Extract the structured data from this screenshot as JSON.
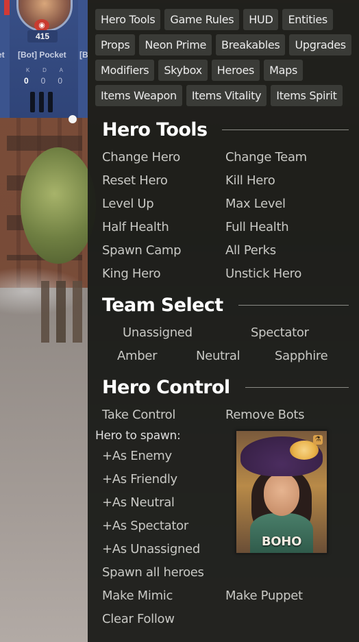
{
  "hud": {
    "players": [
      {
        "name": "et",
        "level": null
      },
      {
        "name": "[Bot] Pocket",
        "level": "415",
        "kda_labels": [
          "K",
          "D",
          "A"
        ],
        "kda": [
          "0",
          "0",
          "0"
        ]
      },
      {
        "name": "[B",
        "level": null
      }
    ]
  },
  "tabs": [
    "Hero Tools",
    "Game Rules",
    "HUD",
    "Entities",
    "Props",
    "Neon Prime",
    "Breakables",
    "Upgrades",
    "Modifiers",
    "Skybox",
    "Heroes",
    "Maps",
    "Items Weapon",
    "Items Vitality",
    "Items Spirit"
  ],
  "sections": {
    "hero_tools": {
      "title": "Hero Tools",
      "items": [
        [
          "Change Hero",
          "Change Team"
        ],
        [
          "Reset Hero",
          "Kill Hero"
        ],
        [
          "Level Up",
          "Max Level"
        ],
        [
          "Half Health",
          "Full Health"
        ],
        [
          "Spawn Camp",
          "All Perks"
        ],
        [
          "King Hero",
          "Unstick Hero"
        ]
      ]
    },
    "team_select": {
      "title": "Team Select",
      "row1": [
        "Unassigned",
        "Spectator"
      ],
      "row2": [
        "Amber",
        "Neutral",
        "Sapphire"
      ]
    },
    "hero_control": {
      "title": "Hero Control",
      "take_control": "Take Control",
      "remove_bots": "Remove Bots",
      "hero_to_spawn": "Hero to spawn:",
      "spawn_options": [
        "+As Enemy",
        "+As Friendly",
        "+As Neutral",
        "+As Spectator",
        "+As Unassigned"
      ],
      "spawn_all": "Spawn all heroes",
      "make_mimic": "Make Mimic",
      "make_puppet": "Make Puppet",
      "clear_follow": "Clear Follow",
      "selected_hero": "BOHO"
    }
  },
  "colors": {
    "panel_bg": "#1a1b18",
    "tab_bg": "#3a3b37",
    "heading": "#ffffff",
    "option_text": "#c8c8c4",
    "hud_blue": "#384f86"
  }
}
